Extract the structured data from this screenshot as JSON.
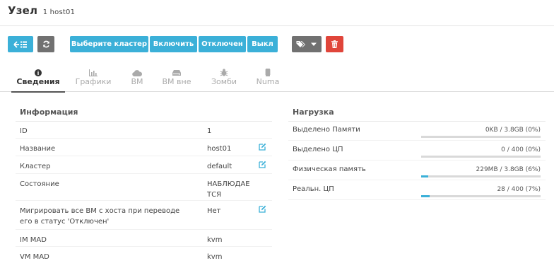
{
  "header": {
    "title": "Узел",
    "subtitle": "1 host01"
  },
  "toolbar": {
    "back_icon": "back-list-icon",
    "refresh_icon": "refresh-icon",
    "select_cluster": "Выберите кластер",
    "enable": "Включить",
    "disable": "Отключен",
    "off": "Выкл",
    "labels_icon": "tags-icon",
    "delete_icon": "trash-icon"
  },
  "tabs": [
    {
      "label": "Сведения",
      "icon": "info-circle-icon"
    },
    {
      "label": "Графики",
      "icon": "bar-chart-icon"
    },
    {
      "label": "ВМ",
      "icon": "cloud-icon"
    },
    {
      "label": "ВМ вне",
      "icon": "hdd-icon"
    },
    {
      "label": "Зомби",
      "icon": "bug-icon"
    },
    {
      "label": "Numa",
      "icon": "microchip-icon"
    }
  ],
  "info": {
    "title": "Информация",
    "rows": [
      {
        "label": "ID",
        "value": "1"
      },
      {
        "label": "Название",
        "value": "host01"
      },
      {
        "label": "Кластер",
        "value": "default"
      },
      {
        "label": "Состояние",
        "value": "НАБЛЮДАЕТСЯ"
      },
      {
        "label": "Мигрировать все ВМ с хоста при переводе его в статус 'Отключен'",
        "value": "Нет"
      },
      {
        "label": "IM MAD",
        "value": "kvm"
      },
      {
        "label": "VM MAD",
        "value": "kvm"
      }
    ]
  },
  "load": {
    "title": "Нагрузка",
    "rows": [
      {
        "label": "Выделено Памяти",
        "value": "0KB / 3.8GB (0%)",
        "percent": 0
      },
      {
        "label": "Выделено ЦП",
        "value": "0 / 400 (0%)",
        "percent": 0
      },
      {
        "label": "Физическая память",
        "value": "229MB / 3.8GB (6%)",
        "percent": 6
      },
      {
        "label": "Реальн. ЦП",
        "value": "28 / 400 (7%)",
        "percent": 7
      }
    ]
  },
  "colors": {
    "accent": "#3bb0d8",
    "grey_button": "#717171",
    "danger": "#e0453a"
  }
}
